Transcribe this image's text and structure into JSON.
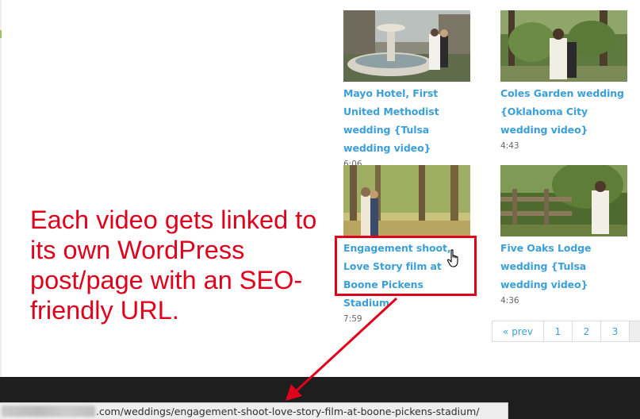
{
  "videos": [
    {
      "title": "Mayo Hotel, First United Methodist wedding {Tulsa wedding video}",
      "duration": "6:06",
      "thumb_icon": "fountain-couple-thumbnail"
    },
    {
      "title": "Coles Garden wedding {Oklahoma City wedding video}",
      "duration": "4:43",
      "thumb_icon": "garden-bride-thumbnail"
    },
    {
      "title": "Engagement shoot, Love Story film at Boone Pickens Stadium",
      "duration": "7:59",
      "thumb_icon": "forest-kiss-thumbnail"
    },
    {
      "title": "Five Oaks Lodge wedding {Tulsa wedding video}",
      "duration": "4:36",
      "thumb_icon": "fence-bride-thumbnail"
    }
  ],
  "annotation": {
    "text": "Each video gets linked to its own WordPress post/page with an SEO-friendly URL.",
    "color": "#e0001b"
  },
  "pagination": {
    "prev_label": "« prev",
    "pages": [
      "1",
      "2",
      "3"
    ]
  },
  "status_bar": {
    "url": ".com/weddings/engagement-shoot-love-story-film-at-boone-pickens-stadium/"
  },
  "colors": {
    "link": "#3b9fd9",
    "footer": "#1e1e1e",
    "highlight": "#e0001b"
  }
}
